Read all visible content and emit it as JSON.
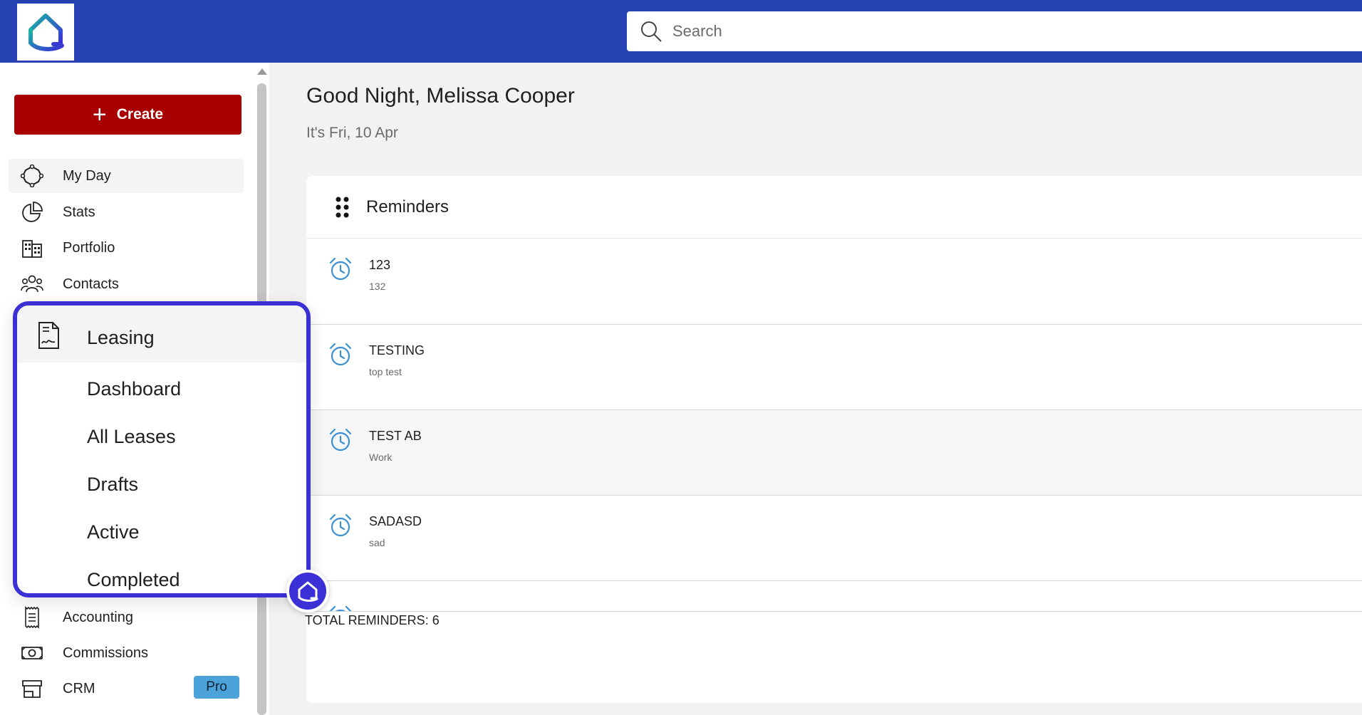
{
  "search": {
    "placeholder": "Search"
  },
  "sidebar": {
    "create_label": "Create",
    "items": [
      {
        "label": "My Day",
        "icon": "my-day-icon"
      },
      {
        "label": "Stats",
        "icon": "pie-chart-icon"
      },
      {
        "label": "Portfolio",
        "icon": "building-icon"
      },
      {
        "label": "Contacts",
        "icon": "people-icon"
      },
      {
        "label": "Accounting",
        "icon": "receipt-icon"
      },
      {
        "label": "Commissions",
        "icon": "cash-icon"
      },
      {
        "label": "CRM",
        "icon": "store-icon",
        "badge": "Pro"
      }
    ]
  },
  "leasing_menu": {
    "label": "Leasing",
    "items": [
      "Dashboard",
      "All Leases",
      "Drafts",
      "Active",
      "Completed"
    ]
  },
  "main": {
    "greeting": "Good Night, Melissa Cooper",
    "date": "It's Fri, 10 Apr"
  },
  "reminders": {
    "title": "Reminders",
    "items": [
      {
        "title": "123",
        "subtitle": "132"
      },
      {
        "title": "TESTING",
        "subtitle": "top test"
      },
      {
        "title": "TEST AB",
        "subtitle": "Work"
      },
      {
        "title": "SADASD",
        "subtitle": "sad"
      }
    ],
    "total": "TOTAL REMINDERS: 6"
  },
  "colors": {
    "topbar": "#2541b2",
    "create_button": "#a80000",
    "highlight_border": "#3b2fd6",
    "pro_badge": "#4ba3d9",
    "alarm_icon": "#3a8fd6"
  }
}
